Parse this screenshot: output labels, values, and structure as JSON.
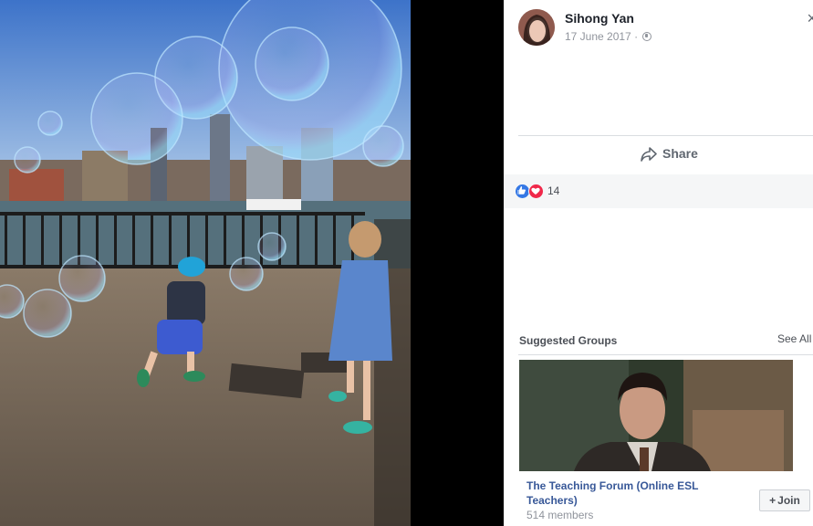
{
  "post": {
    "author": "Sihong Yan",
    "date": "17 June 2017",
    "separator": "·",
    "share_label": "Share",
    "reaction_count": "14"
  },
  "suggested_groups": {
    "title": "Suggested Groups",
    "see_all": "See All",
    "group": {
      "name": "The Teaching Forum (Online ESL Teachers)",
      "members": "514 members",
      "join_label": "Join",
      "join_icon": "+"
    }
  },
  "icons": {
    "globe": "globe-icon",
    "share": "share-arrow-icon",
    "like": "like-reaction-icon",
    "love": "love-reaction-icon"
  },
  "colors": {
    "link": "#385898",
    "like": "#3578e5",
    "love": "#f0284a"
  }
}
